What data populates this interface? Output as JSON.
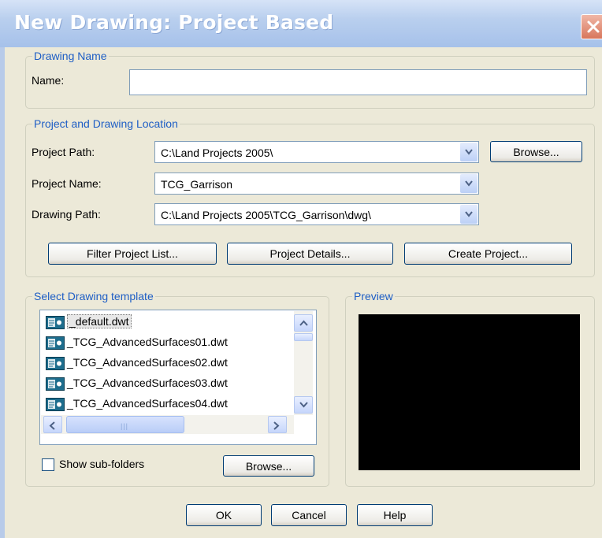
{
  "window": {
    "title": "New Drawing: Project Based"
  },
  "drawing_name": {
    "legend": "Drawing Name",
    "name_label": "Name:",
    "name_value": ""
  },
  "location": {
    "legend": "Project and Drawing Location",
    "project_path_label": "Project Path:",
    "project_path_value": "C:\\Land Projects 2005\\",
    "browse_label": "Browse...",
    "project_name_label": "Project Name:",
    "project_name_value": "TCG_Garrison",
    "drawing_path_label": "Drawing Path:",
    "drawing_path_value": "C:\\Land Projects 2005\\TCG_Garrison\\dwg\\",
    "filter_label": "Filter Project List...",
    "details_label": "Project Details...",
    "create_label": "Create Project..."
  },
  "templates": {
    "legend": "Select Drawing template",
    "items": [
      "_default.dwt",
      "_TCG_AdvancedSurfaces01.dwt",
      "_TCG_AdvancedSurfaces02.dwt",
      "_TCG_AdvancedSurfaces03.dwt",
      "_TCG_AdvancedSurfaces04.dwt"
    ],
    "selected_index": 0,
    "show_subfolders_label": "Show sub-folders",
    "show_subfolders_checked": false,
    "browse_label": "Browse..."
  },
  "preview": {
    "legend": "Preview"
  },
  "footer": {
    "ok_label": "OK",
    "cancel_label": "Cancel",
    "help_label": "Help"
  },
  "colors": {
    "accent": "#1e5ec5",
    "title_bar": "#b9cfee",
    "dialog_bg": "#ece9d8"
  }
}
